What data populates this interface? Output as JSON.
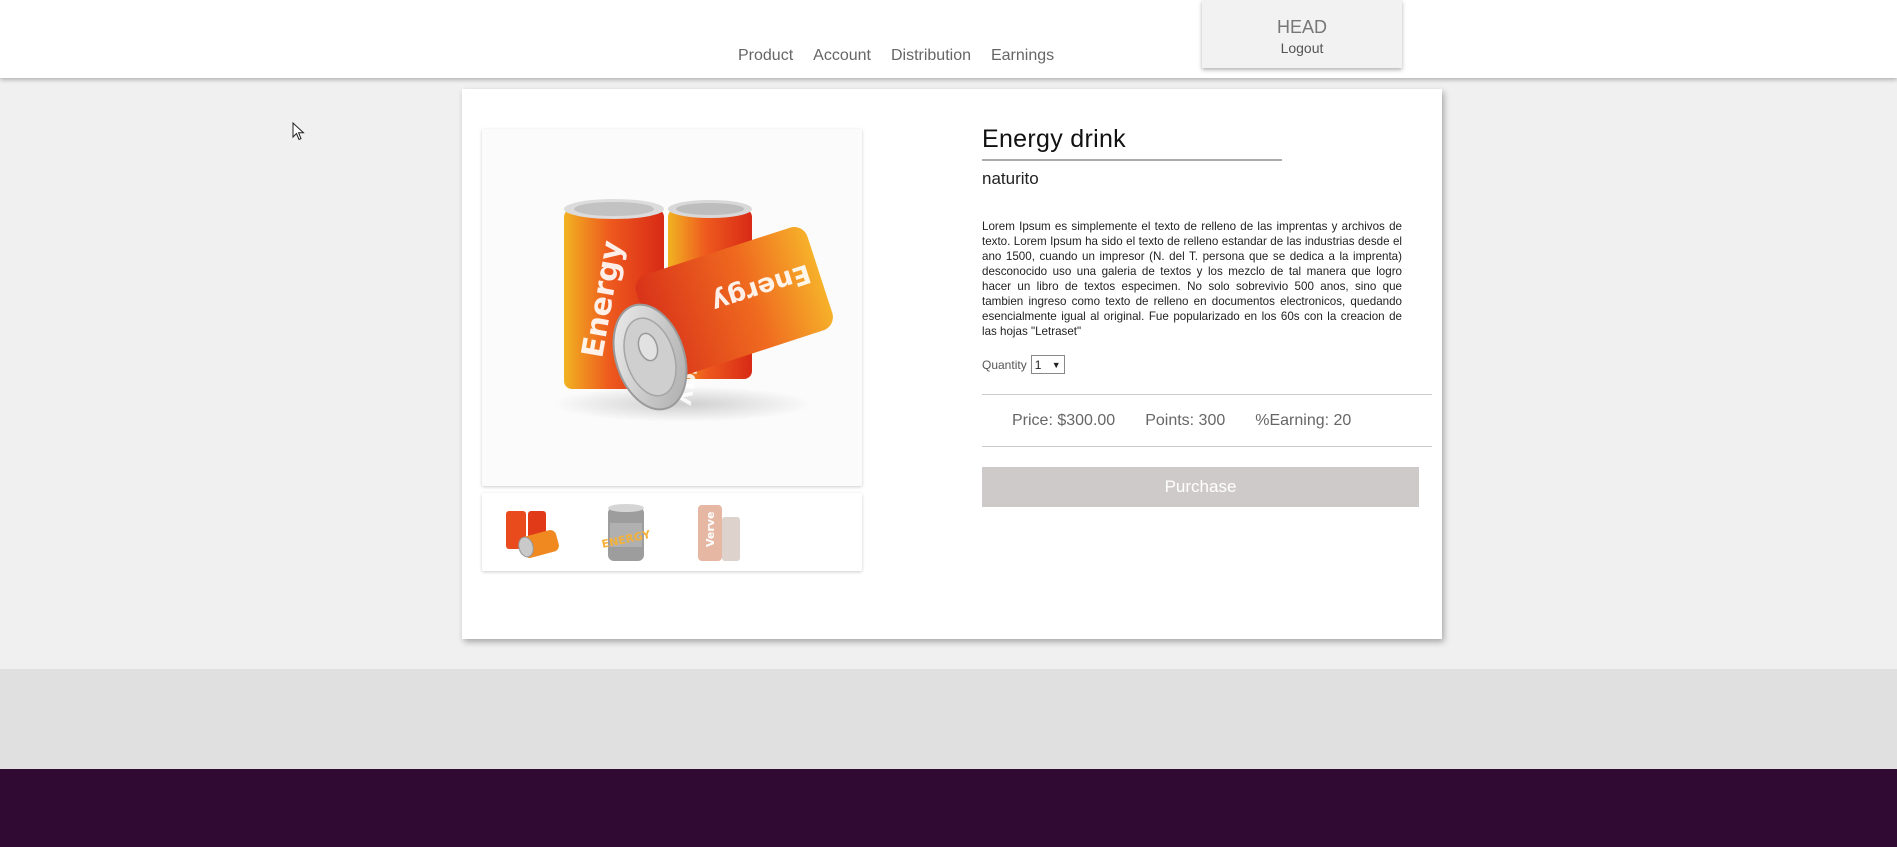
{
  "nav": {
    "items": [
      {
        "label": "Product"
      },
      {
        "label": "Account"
      },
      {
        "label": "Distribution"
      },
      {
        "label": "Earnings"
      }
    ]
  },
  "account": {
    "name": "HEAD",
    "logout_label": "Logout"
  },
  "product": {
    "title": "Energy drink",
    "brand": "naturito",
    "description": "Lorem Ipsum es simplemente el texto de relleno de las imprentas y archivos de texto. Lorem Ipsum ha sido el texto de relleno estandar de las industrias desde el ano 1500, cuando un impresor (N. del T. persona que se dedica a la imprenta) desconocido uso una galeria de textos y los mezclo de tal manera que logro hacer un libro de textos especimen. No solo sobrevivio 500 anos, sino que tambien ingreso como texto de relleno en documentos electronicos, quedando esencialmente igual al original. Fue popularizado en los 60s con la creacion de las hojas \"Letraset\"",
    "quantity_label": "Quantity",
    "quantity_value": "1",
    "price": "Price: $300.00",
    "points": "Points: 300",
    "earning": "%Earning: 20",
    "purchase_label": "Purchase",
    "main_image_icon": "energy-cans-image",
    "thumbnails": [
      {
        "icon": "energy-cans-red-thumbnail"
      },
      {
        "icon": "energy-can-silver-thumbnail"
      },
      {
        "icon": "energy-cans-faded-thumbnail"
      }
    ]
  },
  "colors": {
    "footer_purple": "#310a33",
    "purchase_button": "#cfcaca",
    "can_red": "#e8391d",
    "can_orange": "#f6a21a"
  }
}
